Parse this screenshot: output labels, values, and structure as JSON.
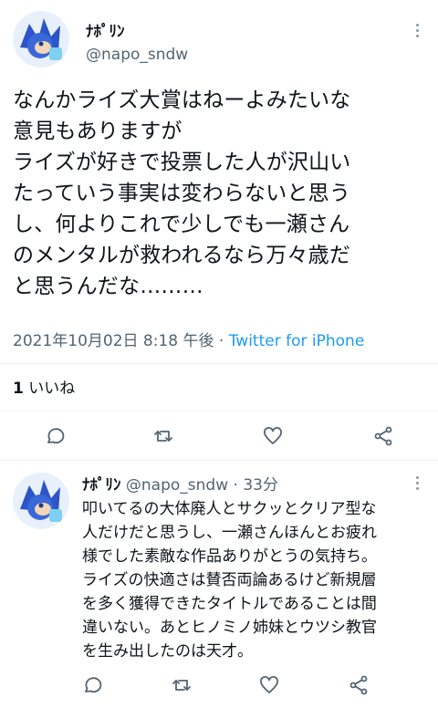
{
  "main_tweet": {
    "author_name": "ﾅﾎﾟﾘﾝ",
    "author_handle": "@napo_sndw",
    "lines": [
      "なんかライズ大賞はねーよみたいな",
      "意見もありますが",
      "ライズが好きで投票した人が沢山い",
      "たっていう事実は変わらないと思う",
      "し、何よりこれで少しでも一瀬さん",
      "のメンタルが救われるなら万々歳だ",
      "と思うんだな………"
    ],
    "timestamp": "2021年10月02日 8:18 午後 · ",
    "source": "Twitter for iPhone",
    "likes_count": "1",
    "likes_label": " いいね"
  },
  "reply": {
    "author_name": "ﾅﾎﾟﾘﾝ",
    "author_handle": "@napo_sndw · 33分",
    "lines": [
      "叩いてるの大体廃人とサクッとクリア型な",
      "人だけだと思うし、一瀬さんほんとお疲れ",
      "様でした素敵な作品ありがとうの気持ち。",
      "ライズの快適さは賛否両論あるけど新規層",
      "を多く獲得できたタイトルであることは間",
      "違いない。あとヒノミノ姉妹とウツシ教官",
      "を生み出したのは天才。"
    ]
  },
  "icons": [
    "reply-icon",
    "retweet-icon",
    "like-icon",
    "share-icon",
    "more-icon"
  ],
  "colors": {
    "link": "#1d9bf0",
    "secondary": "#536471",
    "text": "#0f1419"
  }
}
